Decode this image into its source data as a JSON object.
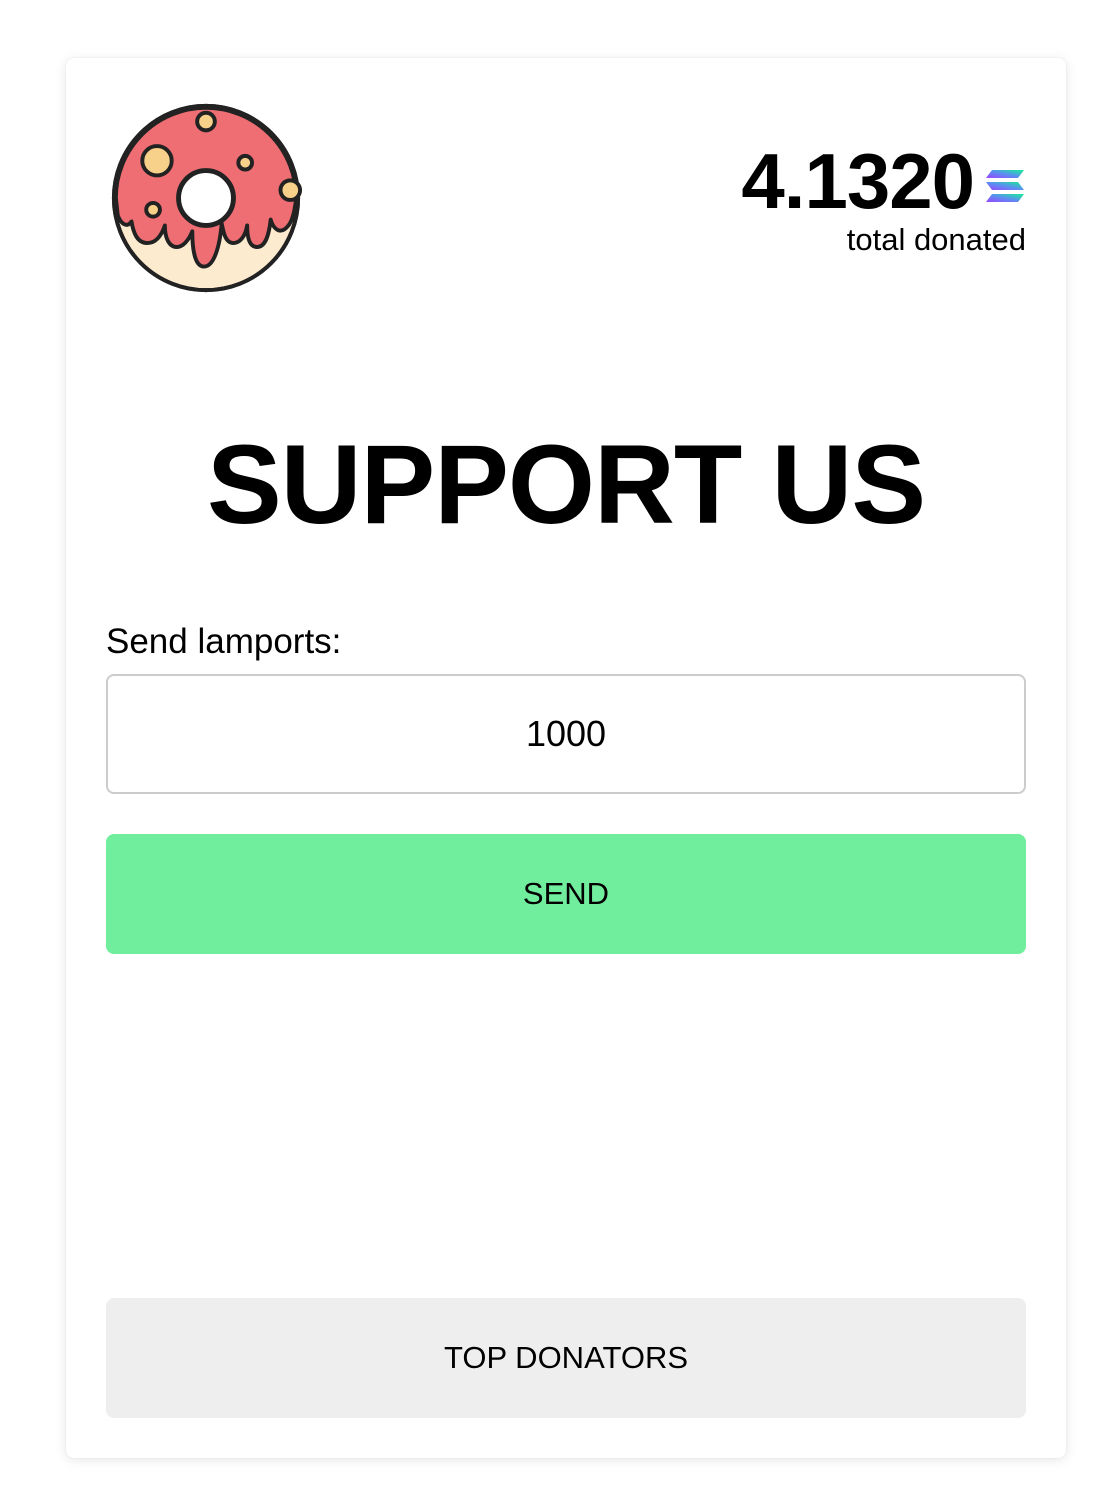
{
  "header": {
    "total_value": "4.1320",
    "total_label": "total donated",
    "currency_icon": "solana-icon",
    "logo_icon": "donut-icon"
  },
  "main": {
    "title": "SUPPORT US",
    "amount_label": "Send lamports:",
    "amount_value": "1000",
    "send_label": "SEND",
    "top_donators_label": "TOP DONATORS"
  },
  "colors": {
    "send_button": "#71ee9d",
    "top_donators_button": "#eeeeee",
    "donut_frosting": "#ee6e73",
    "donut_dough": "#fdebd0",
    "sprinkles": "#f7d08a"
  }
}
